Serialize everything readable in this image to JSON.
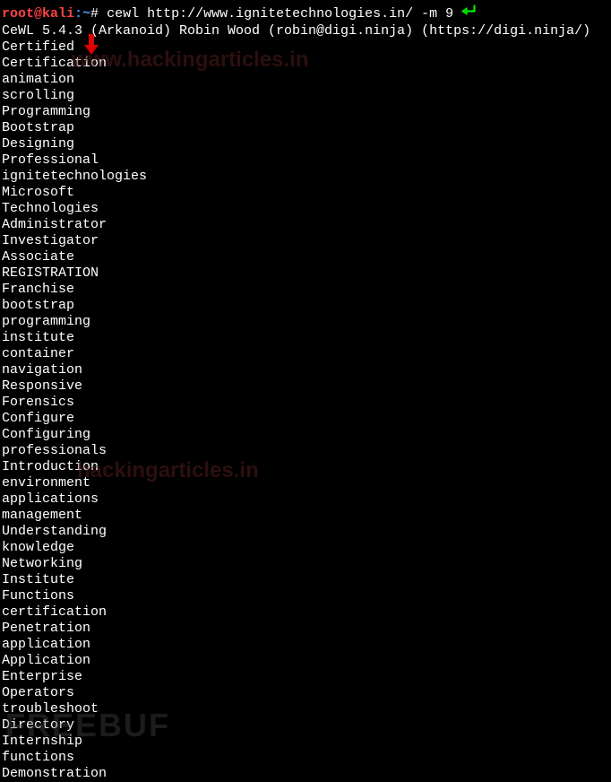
{
  "prompt": {
    "user_host": "root@kali",
    "separator": ":",
    "path": "~",
    "symbol": "#",
    "command": "cewl http://www.ignitetechnologies.in/ -m 9"
  },
  "banner": "CeWL 5.4.3 (Arkanoid) Robin Wood (robin@digi.ninja) (https://digi.ninja/)",
  "words": [
    "Certified",
    "Certification",
    "animation",
    "scrolling",
    "Programming",
    "Bootstrap",
    "Designing",
    "Professional",
    "ignitetechnologies",
    "Microsoft",
    "Technologies",
    "Administrator",
    "Investigator",
    "Associate",
    "REGISTRATION",
    "Franchise",
    "bootstrap",
    "programming",
    "institute",
    "container",
    "navigation",
    "Responsive",
    "Forensics",
    "Configure",
    "Configuring",
    "professionals",
    "Introduction",
    "environment",
    "applications",
    "management",
    "Understanding",
    "knowledge",
    "Networking",
    "Institute",
    "Functions",
    "certification",
    "Penetration",
    "application",
    "Application",
    "Enterprise",
    "Operators",
    "troubleshoot",
    "Directory",
    "Internship",
    "functions",
    "Demonstration"
  ],
  "watermarks": {
    "wm1": "www.hackingarticles.in",
    "wm2": "hackingarticles.in",
    "wm3": "FREEBUF"
  }
}
